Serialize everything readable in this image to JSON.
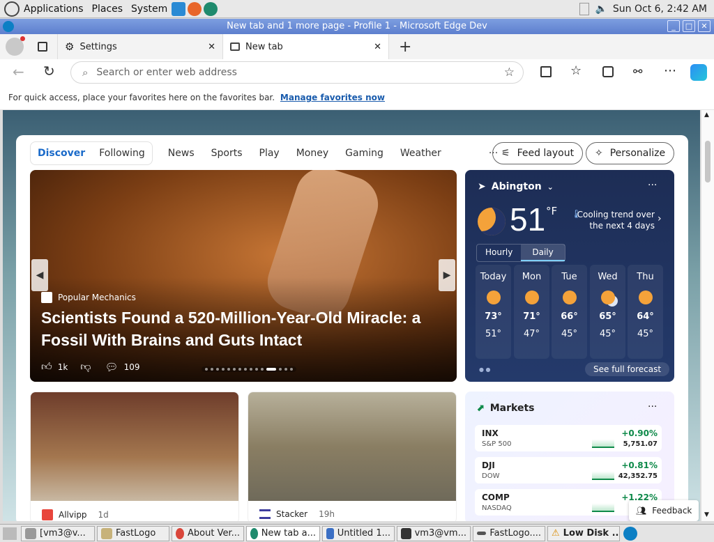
{
  "system_bar": {
    "menus": [
      "Applications",
      "Places",
      "System"
    ],
    "datetime": "Sun Oct  6,  2:42 AM",
    "icons": [
      "launcher-logo-icon",
      "vscode-icon",
      "firefox-icon",
      "edge-dev-icon",
      "keyboard-icon",
      "volume-icon"
    ]
  },
  "window": {
    "title": "New tab and 1 more page - Profile 1 - Microsoft Edge Dev"
  },
  "tabs": [
    {
      "label": "Settings",
      "icon": "gear-icon",
      "active": false
    },
    {
      "label": "New tab",
      "icon": "newtab-icon",
      "active": true
    }
  ],
  "address_bar": {
    "placeholder": "Search or enter web address"
  },
  "favorites_bar": {
    "message": "For quick access, place your favorites here on the favorites bar.",
    "link": "Manage favorites now"
  },
  "feed": {
    "tabs": [
      "Discover",
      "Following"
    ],
    "nav": [
      "News",
      "Sports",
      "Play",
      "Money",
      "Gaming",
      "Weather"
    ],
    "more": "···",
    "feed_layout": "Feed layout",
    "personalize": "Personalize"
  },
  "hero": {
    "source": "Popular Mechanics",
    "headline_1": "Scientists Found a 520-Million-Year-Old Miracle: a",
    "headline_2": "Fossil With Brains and Guts Intact",
    "likes": "1k",
    "comments": "109",
    "active_dot": 11,
    "dots": 15
  },
  "weather": {
    "location": "Abington",
    "temp": "51",
    "unit": "°F",
    "trend_1": "Cooling trend over",
    "trend_2": "the next 4 days",
    "toggle": [
      "Hourly",
      "Daily"
    ],
    "days": [
      {
        "name": "Today",
        "high": "73°",
        "low": "51°"
      },
      {
        "name": "Mon",
        "high": "71°",
        "low": "47°"
      },
      {
        "name": "Tue",
        "high": "66°",
        "low": "45°"
      },
      {
        "name": "Wed",
        "high": "65°",
        "low": "45°"
      },
      {
        "name": "Thu",
        "high": "64°",
        "low": "45°"
      }
    ],
    "see_forecast": "See full forecast"
  },
  "cards": [
    {
      "source": "Allvipp",
      "age": "1d"
    },
    {
      "source": "Stacker",
      "age": "19h"
    }
  ],
  "markets": {
    "title": "Markets",
    "rows": [
      {
        "sym": "INX",
        "name": "S&P 500",
        "change": "+0.90%",
        "value": "5,751.07"
      },
      {
        "sym": "DJI",
        "name": "DOW",
        "change": "+0.81%",
        "value": "42,352.75"
      },
      {
        "sym": "COMP",
        "name": "NASDAQ",
        "change": "+1.22%",
        "value": ""
      }
    ]
  },
  "feedback": "Feedback",
  "taskbar": [
    {
      "label": "[vm3@v...",
      "active": false
    },
    {
      "label": "FastLogo",
      "active": false
    },
    {
      "label": "About Ver...",
      "active": false
    },
    {
      "label": "New tab a...",
      "active": true
    },
    {
      "label": "Untitled 1...",
      "active": false
    },
    {
      "label": "vm3@vm...",
      "active": false
    },
    {
      "label": "FastLogo....",
      "active": false
    },
    {
      "label": "Low Disk ...",
      "active": false
    }
  ]
}
